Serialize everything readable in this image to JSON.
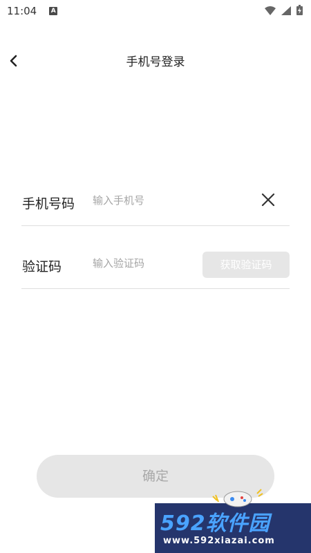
{
  "status_bar": {
    "time": "11:04",
    "notification_icon": "a-icon",
    "wifi_icon": "wifi-icon",
    "signal_icon": "signal-icon",
    "battery_icon": "battery-icon"
  },
  "header": {
    "back_icon": "chevron-left-icon",
    "title": "手机号登录"
  },
  "form": {
    "phone": {
      "label": "手机号码",
      "value": "",
      "placeholder": "输入手机号",
      "clear_icon": "close-icon"
    },
    "code": {
      "label": "验证码",
      "value": "",
      "placeholder": "输入验证码",
      "get_code_label": "获取验证码"
    }
  },
  "confirm_label": "确定",
  "watermark": {
    "brand": "592软件园",
    "url": "www.592xiazai.com"
  },
  "colors": {
    "button_disabled_bg": "#e6e6e6",
    "confirm_text": "#a8a8a8",
    "placeholder": "#a5a5a5",
    "divider": "#dedede",
    "watermark_bg": "#25356c",
    "watermark_accent": "#4aa3ff"
  }
}
